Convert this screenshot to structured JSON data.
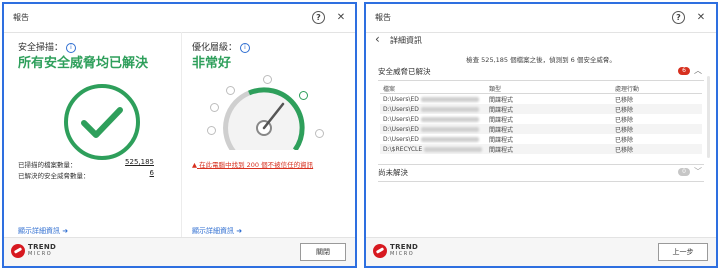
{
  "left": {
    "title": "報告",
    "help_icon": "?",
    "close_icon": "✕",
    "scan_label": "安全掃描：",
    "scan_status": "所有安全威脅均已解決",
    "opt_label": "優化層級：",
    "opt_status": "非常好",
    "stats": [
      {
        "label": "已掃描的檔案數量：",
        "value": "525,185"
      },
      {
        "label": "已解決的安全威脅數量：",
        "value": "6"
      }
    ],
    "warning": "在此電腦中找到 200 個不被信任的資訊",
    "link_left": "顯示詳細資訊",
    "link_right": "顯示詳細資訊",
    "close_button": "關閉",
    "logo_line1": "TREND",
    "logo_line2": "MICRO",
    "colors": {
      "green": "#2e9f5b",
      "warning": "#d7301f",
      "link": "#2f6ed1"
    }
  },
  "right": {
    "title": "報告",
    "help_icon": "?",
    "close_icon": "✕",
    "back_icon": "‹",
    "header": "詳細資訊",
    "summary": "檢查 525,185 個檔案之後，偵測到 6 個安全威脅。",
    "resolved": {
      "label": "安全威脅已解決",
      "count": "6"
    },
    "table": {
      "headers": [
        "檔案",
        "類型",
        "處理行動"
      ],
      "rows": [
        [
          "D:\\Users\\ED",
          "間諜程式",
          "已移除"
        ],
        [
          "D:\\Users\\ED",
          "間諜程式",
          "已移除"
        ],
        [
          "D:\\Users\\ED",
          "間諜程式",
          "已移除"
        ],
        [
          "D:\\Users\\ED",
          "間諜程式",
          "已移除"
        ],
        [
          "D:\\Users\\ED",
          "間諜程式",
          "已移除"
        ],
        [
          "D:\\$RECYCLE",
          "間諜程式",
          "已移除"
        ]
      ]
    },
    "unresolved": {
      "label": "尚未解決",
      "count": "0"
    },
    "prev_button": "上一步",
    "logo_line1": "TREND",
    "logo_line2": "MICRO"
  }
}
